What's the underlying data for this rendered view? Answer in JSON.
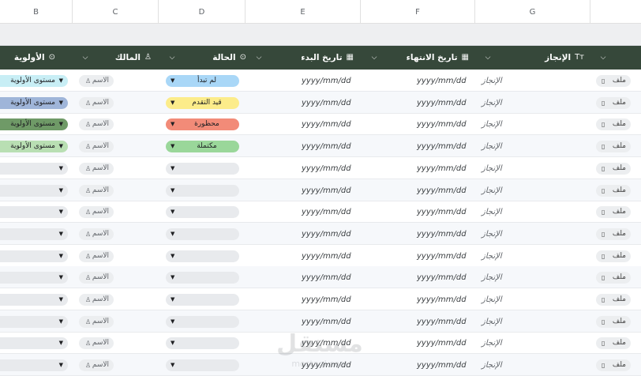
{
  "columns": [
    "B",
    "C",
    "D",
    "E",
    "F",
    "G"
  ],
  "headers": {
    "priority": "الأولوية",
    "owner": "المالك",
    "status": "الحالة",
    "start_date": "تاريخ البدء",
    "end_date": "تاريخ الانتهاء",
    "achievement": "الإنجاز",
    "achievement_icon": "Tт"
  },
  "rows": [
    {
      "priority": "مستوى الأولوية",
      "priority_color": "#c8eef5",
      "owner": "الاسم",
      "status": "لم تبدأ",
      "status_color": "#a9d7f7",
      "start": "yyyy/mm/dd",
      "end": "yyyy/mm/dd",
      "achievement": "الإنجاز",
      "file": "ملف"
    },
    {
      "priority": "مستوى الأولوية",
      "priority_color": "#9fb5d9",
      "owner": "الاسم",
      "status": "قيد التقدم",
      "status_color": "#fcec8a",
      "start": "yyyy/mm/dd",
      "end": "yyyy/mm/dd",
      "achievement": "الإنجاز",
      "file": "ملف"
    },
    {
      "priority": "مستوى الأولوية",
      "priority_color": "#6f9a67",
      "owner": "الاسم",
      "status": "محظورة",
      "status_color": "#f28b78",
      "start": "yyyy/mm/dd",
      "end": "yyyy/mm/dd",
      "achievement": "الإنجاز",
      "file": "ملف"
    },
    {
      "priority": "مستوى الأولوية",
      "priority_color": "#b9dfb3",
      "owner": "الاسم",
      "status": "مكتملة",
      "status_color": "#9ad79a",
      "start": "yyyy/mm/dd",
      "end": "yyyy/mm/dd",
      "achievement": "الإنجاز",
      "file": "ملف"
    },
    {
      "priority": "",
      "priority_color": "#e8eaed",
      "owner": "الاسم",
      "status": "",
      "status_color": "#e8eaed",
      "start": "yyyy/mm/dd",
      "end": "yyyy/mm/dd",
      "achievement": "الإنجاز",
      "file": "ملف"
    },
    {
      "priority": "",
      "priority_color": "#e8eaed",
      "owner": "الاسم",
      "status": "",
      "status_color": "#e8eaed",
      "start": "yyyy/mm/dd",
      "end": "yyyy/mm/dd",
      "achievement": "الإنجاز",
      "file": "ملف"
    },
    {
      "priority": "",
      "priority_color": "#e8eaed",
      "owner": "الاسم",
      "status": "",
      "status_color": "#e8eaed",
      "start": "yyyy/mm/dd",
      "end": "yyyy/mm/dd",
      "achievement": "الإنجاز",
      "file": "ملف"
    },
    {
      "priority": "",
      "priority_color": "#e8eaed",
      "owner": "الاسم",
      "status": "",
      "status_color": "#e8eaed",
      "start": "yyyy/mm/dd",
      "end": "yyyy/mm/dd",
      "achievement": "الإنجاز",
      "file": "ملف"
    },
    {
      "priority": "",
      "priority_color": "#e8eaed",
      "owner": "الاسم",
      "status": "",
      "status_color": "#e8eaed",
      "start": "yyyy/mm/dd",
      "end": "yyyy/mm/dd",
      "achievement": "الإنجاز",
      "file": "ملف"
    },
    {
      "priority": "",
      "priority_color": "#e8eaed",
      "owner": "الاسم",
      "status": "",
      "status_color": "#e8eaed",
      "start": "yyyy/mm/dd",
      "end": "yyyy/mm/dd",
      "achievement": "الإنجاز",
      "file": "ملف"
    },
    {
      "priority": "",
      "priority_color": "#e8eaed",
      "owner": "الاسم",
      "status": "",
      "status_color": "#e8eaed",
      "start": "yyyy/mm/dd",
      "end": "yyyy/mm/dd",
      "achievement": "الإنجاز",
      "file": "ملف"
    },
    {
      "priority": "",
      "priority_color": "#e8eaed",
      "owner": "الاسم",
      "status": "",
      "status_color": "#e8eaed",
      "start": "yyyy/mm/dd",
      "end": "yyyy/mm/dd",
      "achievement": "الإنجاز",
      "file": "ملف"
    },
    {
      "priority": "",
      "priority_color": "#e8eaed",
      "owner": "الاسم",
      "status": "",
      "status_color": "#e8eaed",
      "start": "yyyy/mm/dd",
      "end": "yyyy/mm/dd",
      "achievement": "الإنجاز",
      "file": "ملف"
    },
    {
      "priority": "",
      "priority_color": "#e8eaed",
      "owner": "الاسم",
      "status": "",
      "status_color": "#e8eaed",
      "start": "yyyy/mm/dd",
      "end": "yyyy/mm/dd",
      "achievement": "الإنجاز",
      "file": "ملف"
    }
  ],
  "watermark": {
    "arabic": "مستقل",
    "latin": "mostaql.com"
  },
  "colors": {
    "header_bg": "#36483a",
    "band_bg": "#eeeff1",
    "alt_row": "#f6f8fb"
  },
  "icons": {
    "dropdown": "chevron-down-icon",
    "owner": "person-icon",
    "file": "file-icon",
    "calendar": "calendar-icon",
    "circle": "circle-dropdown-icon"
  }
}
